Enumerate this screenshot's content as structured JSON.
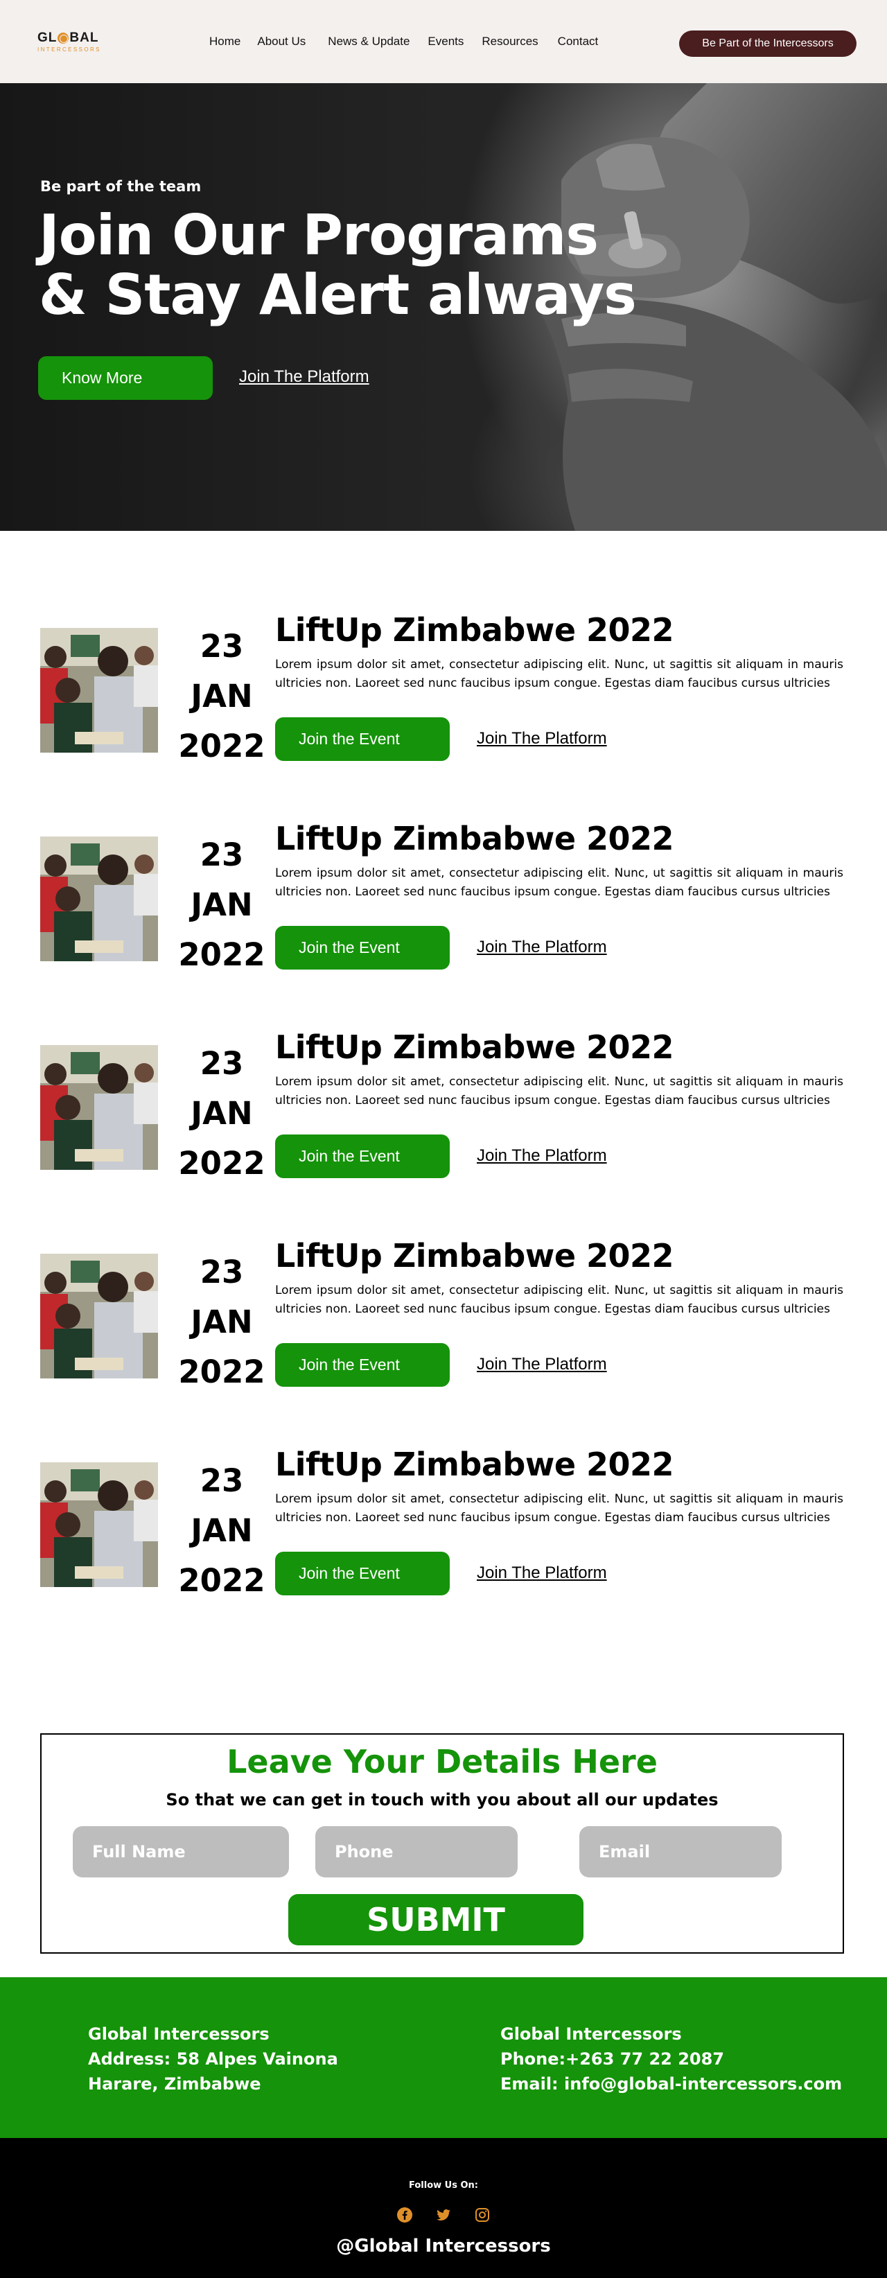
{
  "header": {
    "logo_text": "GLOBAL",
    "logo_sub": "INTERCESSORS",
    "nav": [
      "Home",
      "About Us",
      "News & Update",
      "Events",
      "Resources",
      "Contact"
    ],
    "cta": "Be Part of the Intercessors"
  },
  "hero": {
    "eyebrow": "Be part of the team",
    "title_line1": "Join Our Programs",
    "title_line2": "& Stay Alert always",
    "primary_button": "Know More",
    "secondary_link": "Join The Platform"
  },
  "events": [
    {
      "day": "23",
      "month": "JAN",
      "year": "2022",
      "title": "LiftUp Zimbabwe 2022",
      "description": "Lorem ipsum dolor sit amet, consectetur adipiscing elit. Nunc, ut sagittis sit aliquam in mauris ultricies non. Laoreet sed nunc faucibus ipsum congue. Egestas diam faucibus cursus ultricies",
      "join_label": "Join the Event",
      "platform_label": "Join The Platform"
    },
    {
      "day": "23",
      "month": "JAN",
      "year": "2022",
      "title": "LiftUp Zimbabwe 2022",
      "description": "Lorem ipsum dolor sit amet, consectetur adipiscing elit. Nunc, ut sagittis sit aliquam in mauris ultricies non. Laoreet sed nunc faucibus ipsum congue. Egestas diam faucibus cursus ultricies",
      "join_label": "Join the Event",
      "platform_label": "Join The Platform"
    },
    {
      "day": "23",
      "month": "JAN",
      "year": "2022",
      "title": "LiftUp Zimbabwe 2022",
      "description": "Lorem ipsum dolor sit amet, consectetur adipiscing elit. Nunc, ut sagittis sit aliquam in mauris ultricies non. Laoreet sed nunc faucibus ipsum congue. Egestas diam faucibus cursus ultricies",
      "join_label": "Join the Event",
      "platform_label": "Join The Platform"
    },
    {
      "day": "23",
      "month": "JAN",
      "year": "2022",
      "title": "LiftUp Zimbabwe 2022",
      "description": "Lorem ipsum dolor sit amet, consectetur adipiscing elit. Nunc, ut sagittis sit aliquam in mauris ultricies non. Laoreet sed nunc faucibus ipsum congue. Egestas diam faucibus cursus ultricies",
      "join_label": "Join the Event",
      "platform_label": "Join The Platform"
    },
    {
      "day": "23",
      "month": "JAN",
      "year": "2022",
      "title": "LiftUp Zimbabwe 2022",
      "description": "Lorem ipsum dolor sit amet, consectetur adipiscing elit. Nunc, ut sagittis sit aliquam in mauris ultricies non. Laoreet sed nunc faucibus ipsum congue. Egestas diam faucibus cursus ultricies",
      "join_label": "Join the Event",
      "platform_label": "Join The Platform"
    }
  ],
  "form": {
    "title": "Leave Your Details Here",
    "subtitle": "So that we can get in touch with you about all our updates",
    "name_placeholder": "Full Name",
    "phone_placeholder": "Phone",
    "email_placeholder": "Email",
    "submit": "SUBMIT"
  },
  "footer": {
    "left_line1": "Global Intercessors",
    "left_line2": "Address: 58 Alpes Vainona",
    "left_line3": "Harare, Zimbabwe",
    "right_line1": "Global Intercessors",
    "right_line2": "Phone:+263 77 22 2087",
    "right_line3": "Email: info@global-intercessors.com",
    "follow": "Follow Us On:",
    "socials": [
      "facebook-icon",
      "twitter-icon",
      "instagram-icon"
    ],
    "handle": "@Global Intercessors"
  },
  "colors": {
    "green": "#15930a",
    "maroon": "#4a1d1f",
    "orange": "#e0902a",
    "header_bg": "#f4f0ee"
  }
}
